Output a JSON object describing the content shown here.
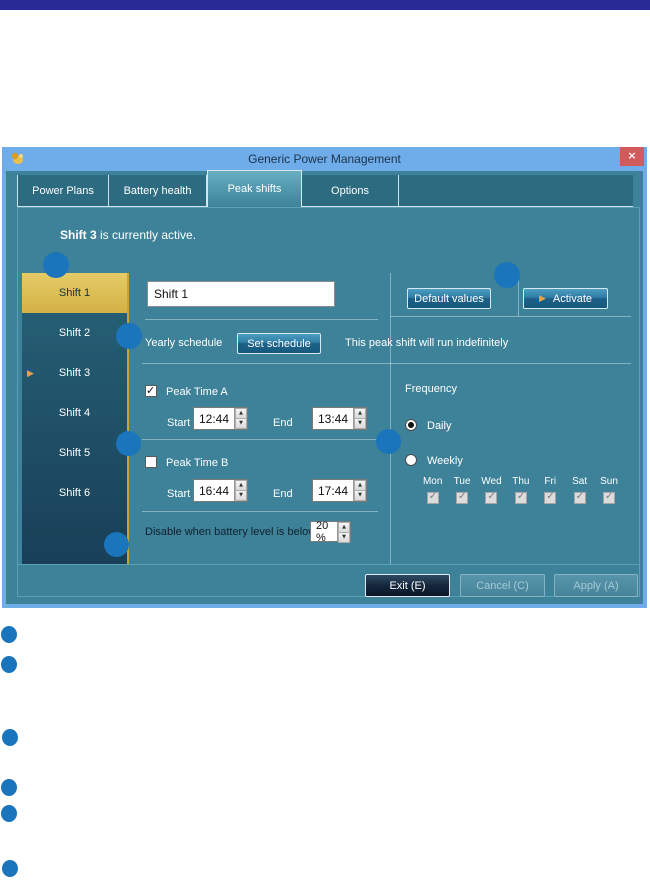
{
  "window": {
    "title": "Generic Power Management",
    "tabs": [
      {
        "label": "Power Plans"
      },
      {
        "label": "Battery health"
      },
      {
        "label": "Peak shifts"
      },
      {
        "label": "Options"
      }
    ],
    "status_bold": "Shift 3",
    "status_rest": " is currently active.",
    "sidebar": {
      "items": [
        {
          "label": "Shift 1"
        },
        {
          "label": "Shift 2"
        },
        {
          "label": "Shift 3"
        },
        {
          "label": "Shift 4"
        },
        {
          "label": "Shift 5"
        },
        {
          "label": "Shift 6"
        }
      ]
    },
    "editor": {
      "name_value": "Shift 1",
      "default_values_label": "Default values",
      "activate_label": "Activate",
      "yearly_label": "Yearly schedule",
      "set_schedule_label": "Set schedule",
      "indefinite_note": "This peak shift will run indefinitely",
      "peak_a": {
        "label": "Peak Time A",
        "start_label": "Start",
        "start": "12:44",
        "end_label": "End",
        "end": "13:44"
      },
      "peak_b": {
        "label": "Peak Time B",
        "start_label": "Start",
        "start": "16:44",
        "end_label": "End",
        "end": "17:44"
      },
      "battery_label": "Disable when battery level is below",
      "battery_value": "20 %",
      "frequency": {
        "title": "Frequency",
        "daily_label": "Daily",
        "weekly_label": "Weekly",
        "days": [
          "Mon",
          "Tue",
          "Wed",
          "Thu",
          "Fri",
          "Sat",
          "Sun"
        ]
      }
    },
    "footer": {
      "exit": "Exit (E)",
      "cancel": "Cancel (C)",
      "apply": "Apply (A)"
    }
  },
  "colors": {
    "callout": "#1B75BC",
    "accent_gold": "#C7A52E",
    "titlebar": "#6FACEA"
  }
}
